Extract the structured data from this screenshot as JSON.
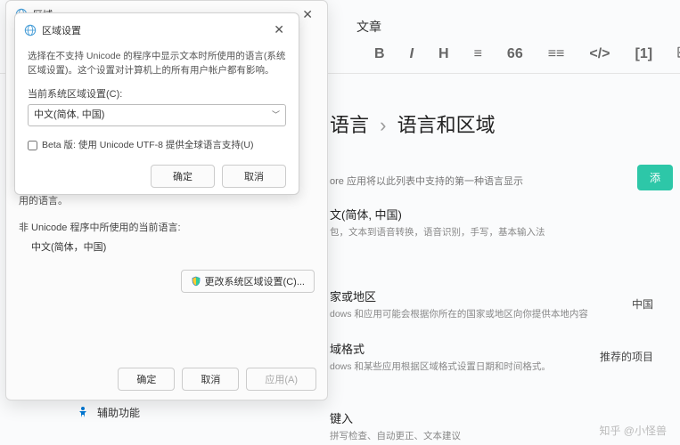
{
  "bg": {
    "header_tab": "文章",
    "toolbar": {
      "b": "B",
      "i": "I",
      "h": "H",
      "eq": "≡",
      "quote": "66",
      "more": "≡≡",
      "code": "</>",
      "brackets": "[1]",
      "insert": "⎘"
    },
    "breadcrumb_part1": "语言",
    "breadcrumb_sep": "›",
    "breadcrumb_part2": "语言和区域",
    "desc_langlist": "ore 应用将以此列表中支持的第一种语言显示",
    "add_btn": "添",
    "sec1_title": "文(简体, 中国)",
    "sec1_sub": "包，文本到语音转换，语音识别，手写，基本输入法",
    "sec2_title": "家或地区",
    "sec2_sub": "dows 和应用可能会根据你所在的国家或地区向你提供本地内容",
    "sec2_value": "中国",
    "sec3_title": "域格式",
    "sec3_sub": "dows 和某些应用根据区域格式设置日期和时间格式。",
    "sec3_value": "推荐的项目",
    "sidebar_item": "辅助功能",
    "keyin_title": "键入",
    "keyin_sub": "拼写检查、自动更正、文本建议"
  },
  "outer": {
    "title": "区域",
    "used_lang": "用的语言。",
    "label_nonunicode": "非 Unicode 程序中所使用的当前语言:",
    "value_nonunicode": "中文(简体，中国)",
    "change_btn": "更改系统区域设置(C)...",
    "ok": "确定",
    "cancel": "取消",
    "apply": "应用(A)"
  },
  "inner": {
    "title": "区域设置",
    "desc": "选择在不支持 Unicode 的程序中显示文本时所使用的语言(系统区域设置)。这个设置对计算机上的所有用户帐户都有影响。",
    "label_current": "当前系统区域设置(C):",
    "dropdown_value": "中文(简体, 中国)",
    "checkbox_label": "Beta 版: 使用 Unicode UTF-8 提供全球语言支持(U)",
    "ok": "确定",
    "cancel": "取消"
  },
  "watermark": "知乎 @小怪兽"
}
